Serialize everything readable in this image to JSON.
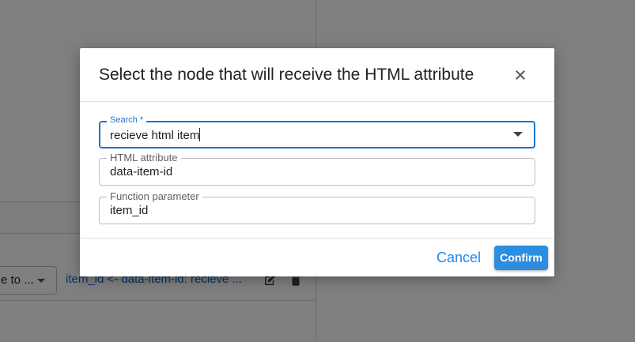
{
  "background": {
    "select_text": "e to ...",
    "mapping_text": "item_id <- data-item-id: recieve ...",
    "edit_icon": "edit-icon",
    "delete_icon": "trash-icon"
  },
  "dialog": {
    "title": "Select the node that will receive the HTML attribute",
    "close_icon": "close-icon",
    "search": {
      "label": "Search *",
      "value": "recieve html item"
    },
    "html_attribute": {
      "label": "HTML attribute",
      "value": "data-item-id"
    },
    "function_parameter": {
      "label": "Function parameter",
      "value": "item_id"
    },
    "cancel_label": "Cancel",
    "confirm_label": "Confirm"
  },
  "colors": {
    "accent": "#1976d2",
    "confirm_bg": "#2d8de0",
    "link": "#1e88e5"
  }
}
